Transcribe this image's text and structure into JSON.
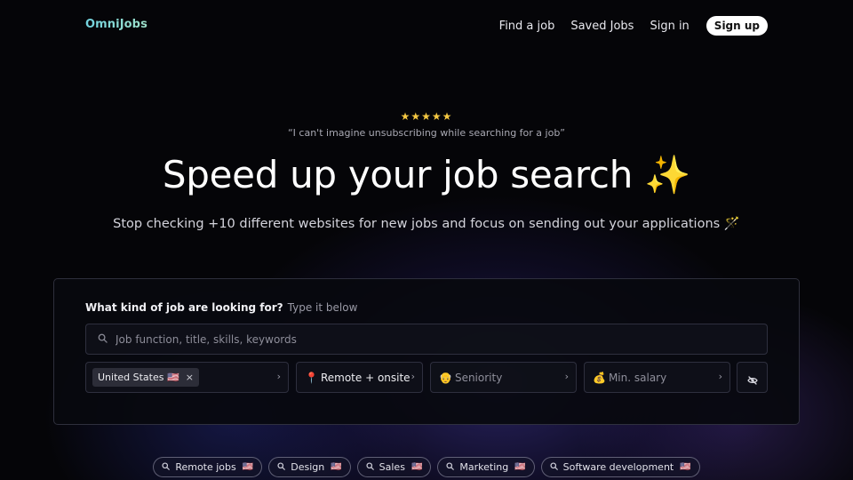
{
  "nav": {
    "logo": "OmniJobs",
    "links": [
      "Find a job",
      "Saved Jobs",
      "Sign in"
    ],
    "signup": "Sign up"
  },
  "hero": {
    "stars": "★★★★★",
    "quote": "“I can't imagine unsubscribing while searching for a job”",
    "headline": "Speed up your job search",
    "headline_emoji": "✨",
    "subtitle": "Stop checking +10 different websites for new jobs and focus on sending out your applications 🪄"
  },
  "search": {
    "question": "What kind of job are looking for?",
    "hint": "Type it below",
    "placeholder": "Job function, title, skills, keywords",
    "location_chip": "United States 🇺🇸",
    "location_remove": "×",
    "remote_emoji": "📍",
    "remote_label": "Remote + onsite",
    "seniority_emoji": "👴",
    "seniority_label": "Seniority",
    "salary_emoji": "💰",
    "salary_label": "Min. salary",
    "chevron": "›"
  },
  "tags": [
    {
      "label": "Remote jobs",
      "flag": "🇺🇸"
    },
    {
      "label": "Design",
      "flag": "🇺🇸"
    },
    {
      "label": "Sales",
      "flag": "🇺🇸"
    },
    {
      "label": "Marketing",
      "flag": "🇺🇸"
    },
    {
      "label": "Software development",
      "flag": "🇺🇸"
    }
  ],
  "colors": {
    "logo": "#7fd8e0",
    "stars": "#f5c842",
    "signup_bg": "#ffffff",
    "background": "#050508"
  },
  "icons": {
    "search": "search-icon",
    "hide": "eye-off-icon",
    "chevron": "chevron-right-icon"
  }
}
